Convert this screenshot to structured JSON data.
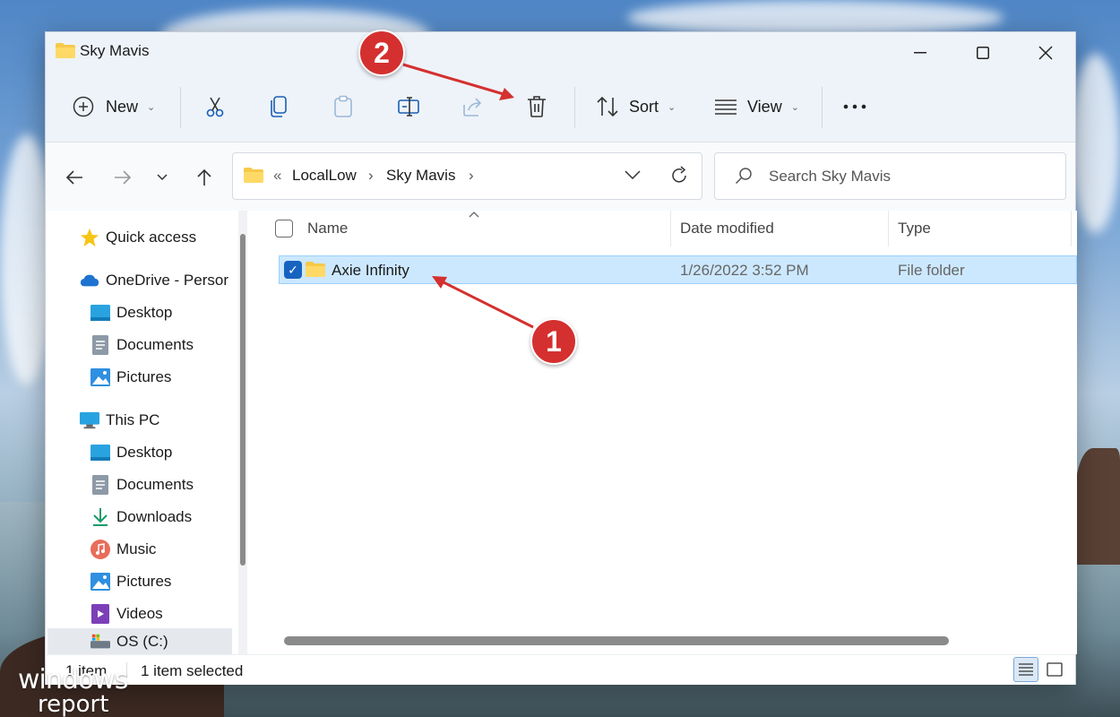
{
  "window": {
    "title": "Sky Mavis"
  },
  "toolbar": {
    "new_label": "New",
    "sort_label": "Sort",
    "view_label": "View"
  },
  "address": {
    "overflow": "«",
    "parts": [
      "LocalLow",
      "Sky Mavis"
    ],
    "separator": "›"
  },
  "search": {
    "placeholder": "Search Sky Mavis"
  },
  "sidebar": {
    "items": [
      {
        "label": "Quick access",
        "icon": "star-icon"
      },
      {
        "label": "OneDrive - Persor",
        "icon": "cloud-icon"
      },
      {
        "label": "Desktop",
        "icon": "desktop-icon"
      },
      {
        "label": "Documents",
        "icon": "document-icon"
      },
      {
        "label": "Pictures",
        "icon": "pictures-icon"
      },
      {
        "label": "This PC",
        "icon": "computer-icon"
      },
      {
        "label": "Desktop",
        "icon": "desktop-icon"
      },
      {
        "label": "Documents",
        "icon": "document-icon"
      },
      {
        "label": "Downloads",
        "icon": "download-icon"
      },
      {
        "label": "Music",
        "icon": "music-icon"
      },
      {
        "label": "Pictures",
        "icon": "pictures-icon"
      },
      {
        "label": "Videos",
        "icon": "videos-icon"
      },
      {
        "label": "OS (C:)",
        "icon": "drive-icon"
      }
    ]
  },
  "columns": {
    "name": "Name",
    "date": "Date modified",
    "type": "Type"
  },
  "files": [
    {
      "name": "Axie Infinity",
      "date": "1/26/2022 3:52 PM",
      "type": "File folder",
      "selected": true
    }
  ],
  "status": {
    "count": "1 item",
    "selection": "1 item selected"
  },
  "annotations": {
    "step1": "1",
    "step2": "2",
    "color": "#d4302f"
  },
  "watermark": {
    "line1": "windows",
    "line2": "report"
  },
  "colors": {
    "accent": "#1763c0",
    "selection_bg": "#cce8ff",
    "folder": "#f6c94a"
  }
}
